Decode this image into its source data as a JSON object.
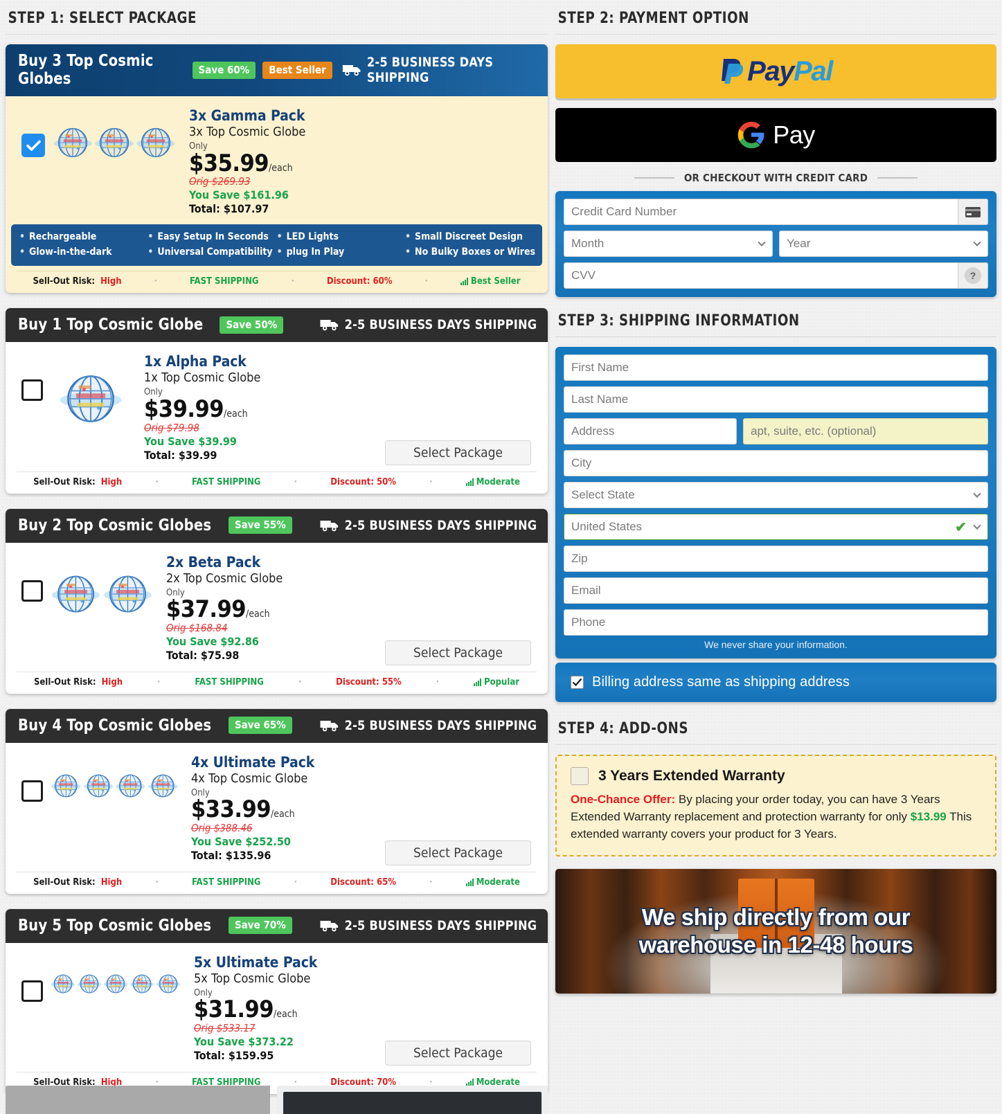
{
  "steps": {
    "step1": "STEP 1: SELECT PACKAGE",
    "step2": "STEP 2: PAYMENT OPTION",
    "step3": "STEP 3: SHIPPING INFORMATION",
    "step4": "STEP 4: ADD-ONS"
  },
  "shipping_label": "2-5 BUSINESS DAYS SHIPPING",
  "select_package_label": "Select Package",
  "only_label": "Only",
  "each_label": "/each",
  "features": [
    [
      "Rechargeable",
      "Glow-in-the-dark"
    ],
    [
      "Easy Setup In Seconds",
      "Universal Compatibility"
    ],
    [
      "LED Lights",
      "plug In Play"
    ],
    [
      "Small Discreet Design",
      "No Bulky Boxes or Wires"
    ]
  ],
  "packages": [
    {
      "header_title": "Buy 3 Top Cosmic Globes",
      "save_badge": "Save 60%",
      "best_seller_badge": "Best Seller",
      "name": "3x Gamma Pack",
      "subtitle": "3x Top Cosmic Globe",
      "price": "$35.99",
      "orig": "Orig $269.93",
      "you_save": "You Save $161.96",
      "total": "Total: $107.97",
      "qty": 3,
      "selected": true,
      "footer": {
        "risk_label": "Sell-Out Risk:",
        "risk_value": "High",
        "shipping": "FAST SHIPPING",
        "discount": "Discount: 60%",
        "popularity": "Best Seller"
      }
    },
    {
      "header_title": "Buy 1 Top Cosmic Globe",
      "save_badge": "Save 50%",
      "best_seller_badge": "",
      "name": "1x Alpha Pack",
      "subtitle": "1x Top Cosmic Globe",
      "price": "$39.99",
      "orig": "Orig $79.98",
      "you_save": "You Save $39.99",
      "total": "Total: $39.99",
      "qty": 1,
      "selected": false,
      "footer": {
        "risk_label": "Sell-Out Risk:",
        "risk_value": "High",
        "shipping": "FAST SHIPPING",
        "discount": "Discount: 50%",
        "popularity": "Moderate"
      }
    },
    {
      "header_title": "Buy 2 Top Cosmic Globes",
      "save_badge": "Save 55%",
      "best_seller_badge": "",
      "name": "2x Beta Pack",
      "subtitle": "2x Top Cosmic Globe",
      "price": "$37.99",
      "orig": "Orig $168.84",
      "you_save": "You Save $92.86",
      "total": "Total: $75.98",
      "qty": 2,
      "selected": false,
      "footer": {
        "risk_label": "Sell-Out Risk:",
        "risk_value": "High",
        "shipping": "FAST SHIPPING",
        "discount": "Discount: 55%",
        "popularity": "Popular"
      }
    },
    {
      "header_title": "Buy 4 Top Cosmic Globes",
      "save_badge": "Save 65%",
      "best_seller_badge": "",
      "name": "4x Ultimate Pack",
      "subtitle": "4x Top Cosmic Globe",
      "price": "$33.99",
      "orig": "Orig $388.46",
      "you_save": "You Save $252.50",
      "total": "Total: $135.96",
      "qty": 4,
      "selected": false,
      "footer": {
        "risk_label": "Sell-Out Risk:",
        "risk_value": "High",
        "shipping": "FAST SHIPPING",
        "discount": "Discount: 65%",
        "popularity": "Moderate"
      }
    },
    {
      "header_title": "Buy 5 Top Cosmic Globes",
      "save_badge": "Save 70%",
      "best_seller_badge": "",
      "name": "5x Ultimate Pack",
      "subtitle": "5x Top Cosmic Globe",
      "price": "$31.99",
      "orig": "Orig $533.17",
      "you_save": "You Save $373.22",
      "total": "Total: $159.95",
      "qty": 5,
      "selected": false,
      "footer": {
        "risk_label": "Sell-Out Risk:",
        "risk_value": "High",
        "shipping": "FAST SHIPPING",
        "discount": "Discount: 70%",
        "popularity": "Moderate"
      }
    }
  ],
  "payment": {
    "paypal_pay": "Pay",
    "paypal_pal": "Pal",
    "gpay_label": "Pay",
    "or_divider": "OR CHECKOUT WITH CREDIT CARD",
    "card_number_placeholder": "Credit Card Number",
    "month_placeholder": "Month",
    "year_placeholder": "Year",
    "cvv_placeholder": "CVV",
    "cvv_help": "?"
  },
  "shipping_form": {
    "first_name": "First Name",
    "last_name": "Last Name",
    "address": "Address",
    "apt": "apt, suite, etc. (optional)",
    "city": "City",
    "state": "Select State",
    "country": "United States",
    "zip": "Zip",
    "email": "Email",
    "phone": "Phone",
    "note": "We never share your information.",
    "billing_same": "Billing address same as shipping address"
  },
  "addons": {
    "warranty_title": "3 Years Extended Warranty",
    "offer_label": "One-Chance Offer:",
    "offer_text_1": " By placing your order today, you can have 3 Years Extended Warranty replacement and protection warranty for only ",
    "offer_price": "$13.99",
    "offer_text_2": " This extended warranty covers your product for 3 Years."
  },
  "banner": {
    "line1": "We ship directly from our",
    "line2": "warehouse in 12-48 hours"
  },
  "colors": {
    "accent_blue": "#1378bf",
    "save_green": "#4fc65c",
    "best_seller_orange": "#e8861a",
    "paypal_yellow": "#f7bf2e",
    "selected_cream": "#fdf2cf",
    "header_dark": "#2e2e2e",
    "red": "#e02020",
    "green": "#18a34a"
  }
}
